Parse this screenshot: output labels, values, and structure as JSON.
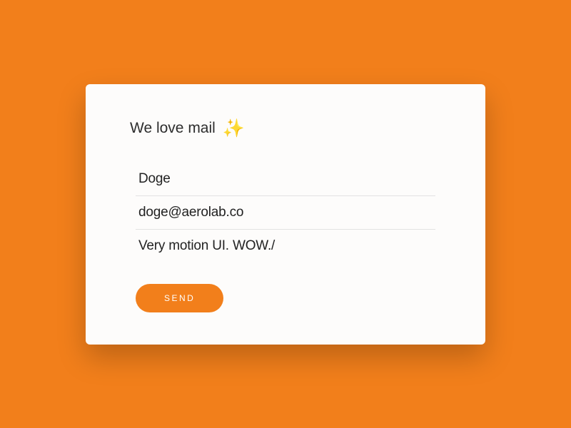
{
  "form": {
    "heading": "We love mail",
    "icon": "✨",
    "fields": {
      "name": "Doge",
      "email": "doge@aerolab.co",
      "message": "Very motion UI. WOW./"
    },
    "submit_label": "SEND"
  }
}
